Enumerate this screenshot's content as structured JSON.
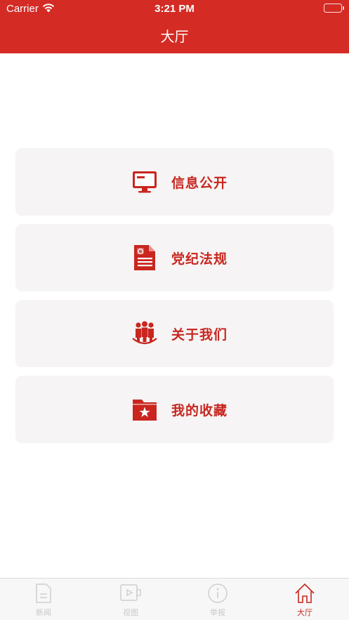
{
  "status_bar": {
    "carrier": "Carrier",
    "time": "3:21 PM"
  },
  "header": {
    "title": "大厅"
  },
  "menu": [
    {
      "label": "信息公开",
      "icon": "monitor-icon"
    },
    {
      "label": "党纪法规",
      "icon": "document-icon"
    },
    {
      "label": "关于我们",
      "icon": "people-icon"
    },
    {
      "label": "我的收藏",
      "icon": "star-folder-icon"
    }
  ],
  "tabs": [
    {
      "label": "新闻",
      "icon": "document-icon",
      "active": false
    },
    {
      "label": "视图",
      "icon": "video-icon",
      "active": false
    },
    {
      "label": "举报",
      "icon": "info-icon",
      "active": false
    },
    {
      "label": "大厅",
      "icon": "home-icon",
      "active": true
    }
  ],
  "colors": {
    "brand_red": "#d42b25",
    "accent_red": "#c8261f",
    "card_bg": "#f6f4f4",
    "tab_inactive": "#c9c9c9"
  }
}
